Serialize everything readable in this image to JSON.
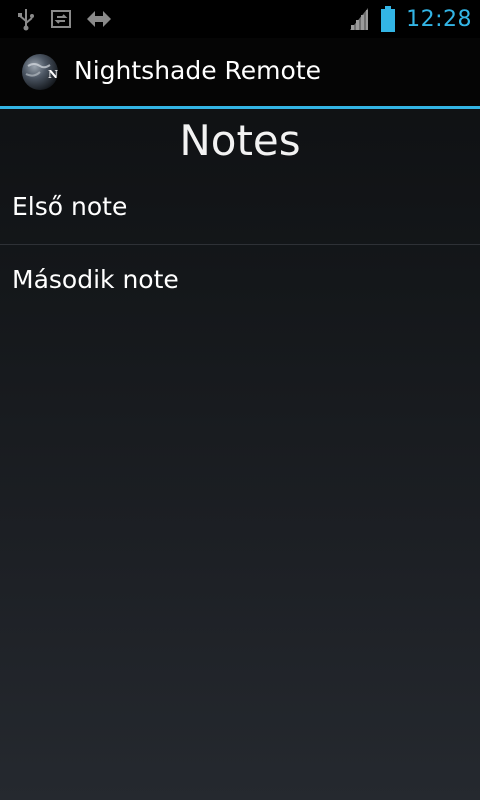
{
  "status_bar": {
    "time": "12:28",
    "icons": [
      "usb-icon",
      "sync-icon",
      "transfer-arrows-icon",
      "signal-icon",
      "battery-icon"
    ],
    "accent_color": "#33b5e5",
    "icon_color": "#8a8a8a"
  },
  "action_bar": {
    "app_title": "Nightshade Remote",
    "app_icon": "nightshade-logo"
  },
  "content": {
    "heading": "Notes",
    "notes": [
      {
        "label": "Első note"
      },
      {
        "label": "Második note"
      }
    ]
  }
}
